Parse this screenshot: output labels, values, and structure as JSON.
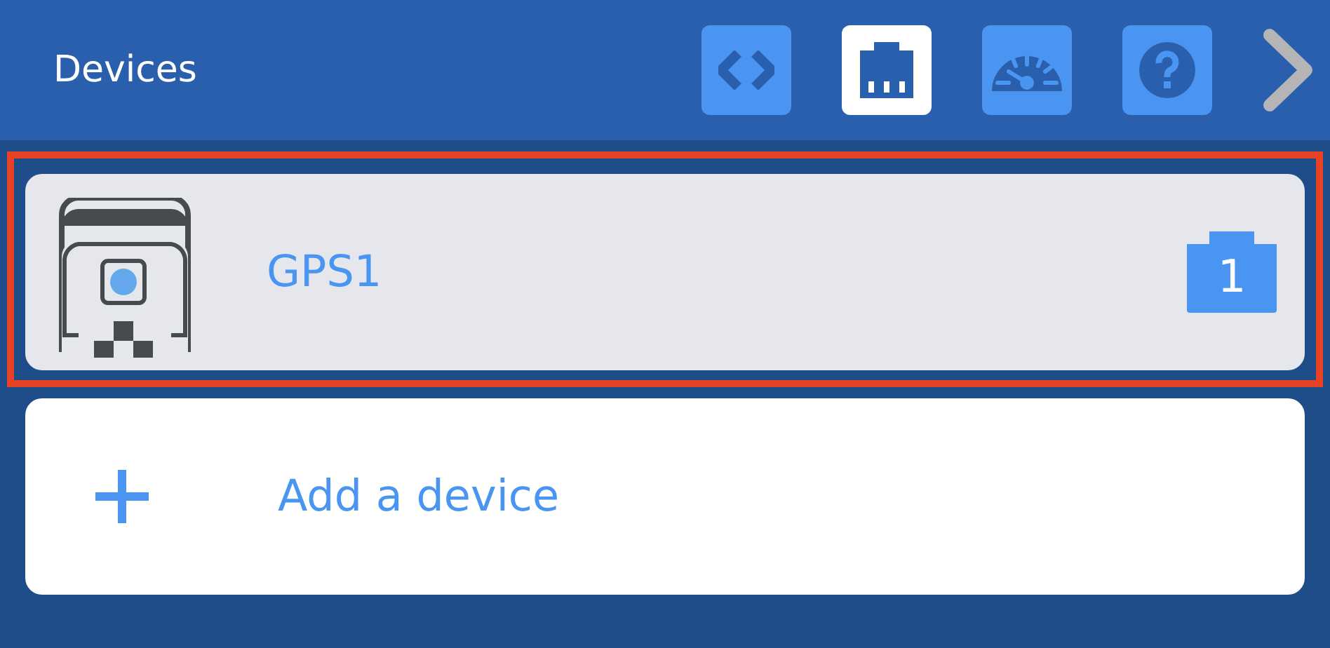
{
  "header": {
    "title": "Devices"
  },
  "toolbar": [
    {
      "kind": "code",
      "selected": false
    },
    {
      "kind": "port",
      "selected": true
    },
    {
      "kind": "gauge",
      "selected": false
    },
    {
      "kind": "help",
      "selected": false
    }
  ],
  "devices": [
    {
      "name": "GPS1",
      "badge": "1",
      "selected": true
    }
  ],
  "add_device": {
    "label": "Add a device"
  }
}
